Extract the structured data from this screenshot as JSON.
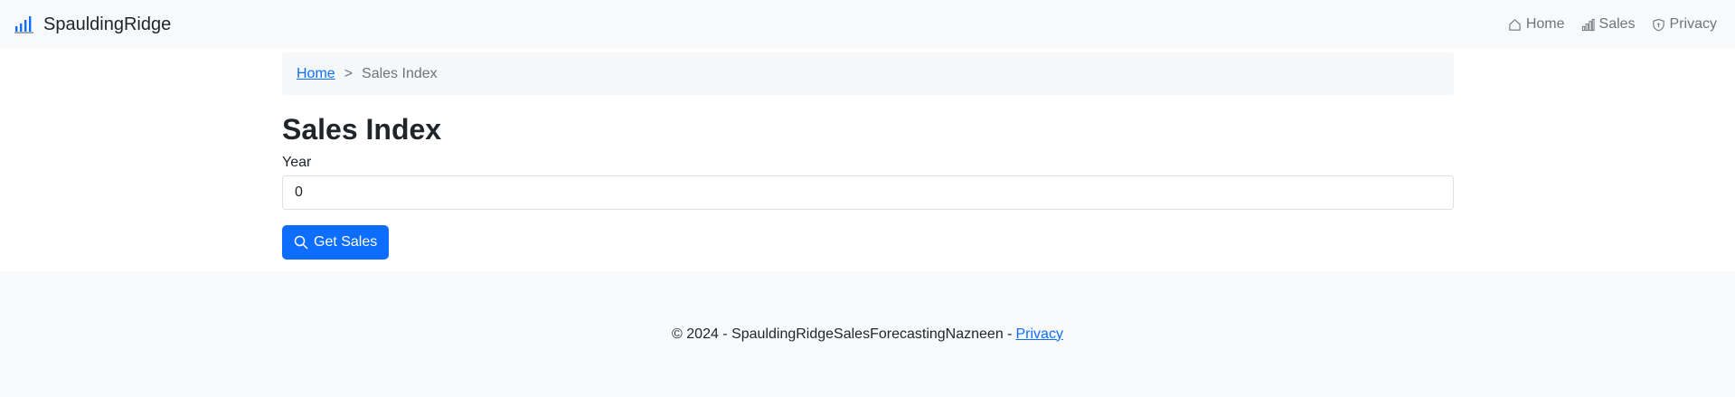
{
  "navbar": {
    "brand": "SpauldingRidge",
    "brand_icon": "bar-chart-icon",
    "links": [
      {
        "label": "Home",
        "icon": "house-icon"
      },
      {
        "label": "Sales",
        "icon": "bar-chart-icon"
      },
      {
        "label": "Privacy",
        "icon": "shield-icon"
      }
    ]
  },
  "breadcrumb": {
    "home": "Home",
    "separator": ">",
    "current": "Sales Index"
  },
  "main": {
    "title": "Sales Index",
    "year_label": "Year",
    "year_value": "0",
    "button_label": "Get Sales",
    "button_icon": "search-icon"
  },
  "footer": {
    "text": "© 2024 - SpauldingRidgeSalesForecastingNazneen -",
    "privacy_link": "Privacy"
  },
  "colors": {
    "primary": "#0d6efd",
    "navbar_bg": "#f8f9fa",
    "muted": "#6c757d"
  }
}
